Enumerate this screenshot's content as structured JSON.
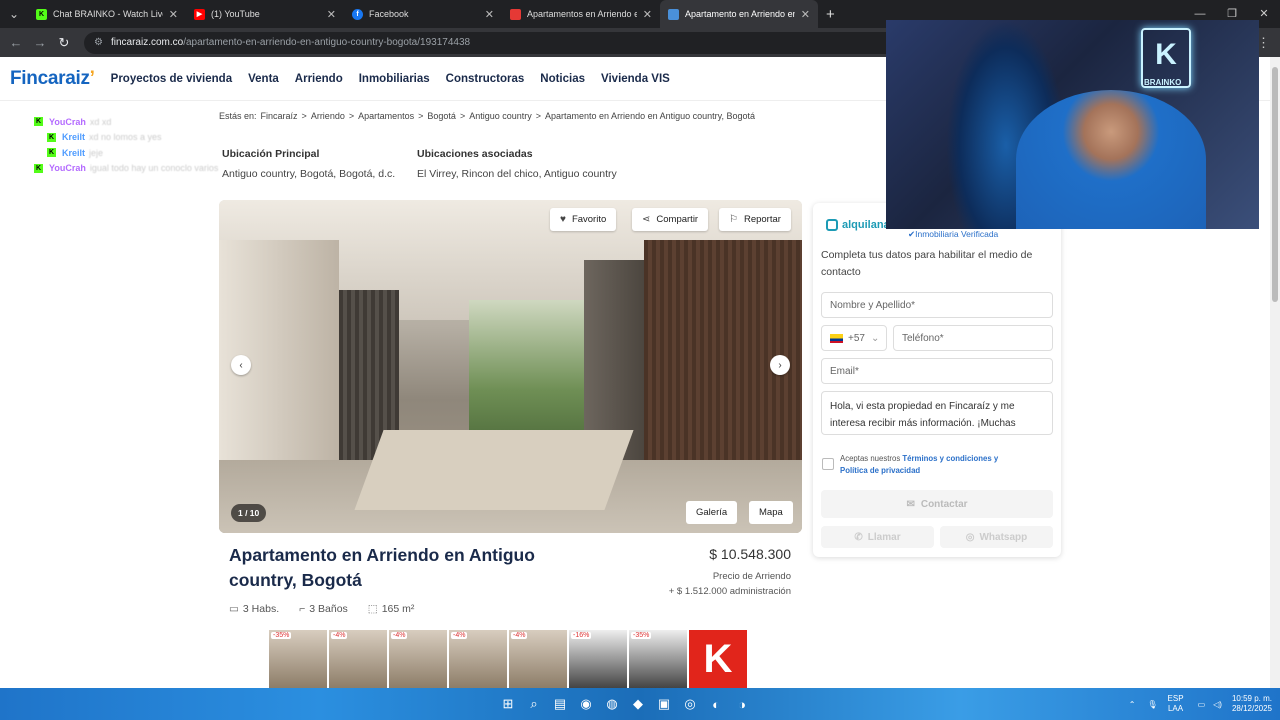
{
  "browser": {
    "tabs": [
      {
        "title": "Chat BRAINKO - Watch Live on",
        "icon": "kick-icon"
      },
      {
        "title": "(1) YouTube",
        "icon": "youtube-icon"
      },
      {
        "title": "Facebook",
        "icon": "facebook-icon"
      },
      {
        "title": "Apartamentos en Arriendo en",
        "icon": "page-icon"
      },
      {
        "title": "Apartamento en Arriendo en B",
        "icon": "page-icon"
      }
    ],
    "url_domain": "fincaraiz.com.co",
    "url_path": "/apartamento-en-arriendo-en-antiguo-country-bogota/193174438"
  },
  "site": {
    "logo": "Fincaraiz",
    "nav": [
      "Proyectos de vivienda",
      "Venta",
      "Arriendo",
      "Inmobiliarias",
      "Constructoras",
      "Noticias",
      "Vivienda VIS"
    ]
  },
  "chat": [
    {
      "user": "YouCrah",
      "msg": "xd xd",
      "color": "#b46bff"
    },
    {
      "user": "Kreilt",
      "msg": "xd no lomos a yes",
      "color": "#4f9cff"
    },
    {
      "user": "Kreilt",
      "msg": "jeje",
      "color": "#4f9cff"
    },
    {
      "user": "YouCrah",
      "msg": "igual todo hay un conoclo varios",
      "color": "#b46bff"
    }
  ],
  "breadcrumb": {
    "prefix": "Estás en:",
    "items": [
      "Fincaraíz",
      "Arriendo",
      "Apartamentos",
      "Bogotá",
      "Antiguo country",
      "Apartamento en Arriendo en Antiguo country, Bogotá"
    ]
  },
  "location": {
    "main_label": "Ubicación Principal",
    "main_value": "Antiguo country, Bogotá, Bogotá, d.c.",
    "assoc_label": "Ubicaciones asociadas",
    "assoc_value": "El Virrey, Rincon del chico, Antiguo country"
  },
  "gallery": {
    "favorite": "Favorito",
    "share": "Compartir",
    "report": "Reportar",
    "counter": "1 / 10",
    "gallery_btn": "Galería",
    "map_btn": "Mapa"
  },
  "listing": {
    "title": "Apartamento en Arriendo en Antiguo country, Bogotá",
    "habs": "3 Habs.",
    "banos": "3 Baños",
    "area": "165 m²",
    "price": "$ 10.548.300",
    "price_label": "Precio de Arriendo",
    "admin": "+ $ 1.512.000 administración"
  },
  "form": {
    "brand": "alquilana",
    "verified": "Inmobiliaria Verificada",
    "intro": "Completa tus datos para habilitar el medio de contacto",
    "name_placeholder": "Nombre y Apellido*",
    "country_code": "+57",
    "phone_placeholder": "Teléfono*",
    "email_placeholder": "Email*",
    "message": "Hola, vi esta propiedad en Fincaraíz y me interesa recibir más información. ¡Muchas",
    "terms_prefix": "Aceptas nuestros",
    "terms_link": "Términos y condiciones",
    "terms_and": "y",
    "privacy_link": "Política de privacidad",
    "contact_btn": "Contactar",
    "call_btn": "Llamar",
    "whatsapp_btn": "Whatsapp"
  },
  "webcam": {
    "logo_letter": "K",
    "logo_text": "BRAINKO"
  },
  "ads": [
    {
      "discount": "-35%"
    },
    {
      "discount": "-4%"
    },
    {
      "discount": "-4%"
    },
    {
      "discount": "-4%"
    },
    {
      "discount": "-4%"
    },
    {
      "discount": "-16%"
    },
    {
      "discount": "-35%"
    },
    {
      "discount": "K"
    }
  ],
  "taskbar": {
    "lang_top": "ESP",
    "lang_bottom": "LAA",
    "time": "10:59 p. m.",
    "date": "28/12/2025"
  }
}
